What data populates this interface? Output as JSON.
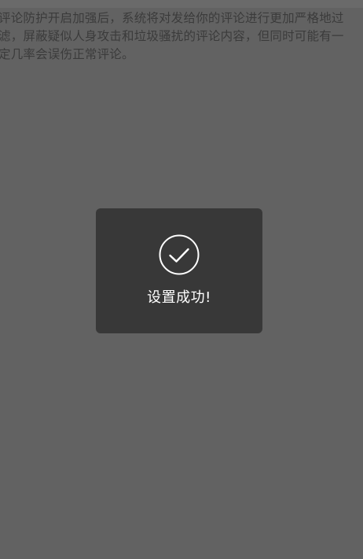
{
  "background": {
    "description_text": "评论防护开启加强后，系统将对发给你的评论进行更加严格地过\n滤，屏蔽疑似人身攻击和垃圾骚扰的评论内容，但同时可能有一\n定几率会误伤正常评论。"
  },
  "toast": {
    "icon": "check-circle-icon",
    "message": "设置成功!"
  },
  "colors": {
    "overlay": "#626262",
    "toast_bg": "#383838",
    "toast_text": "#ffffff",
    "description_text": "#3b3b3b"
  }
}
